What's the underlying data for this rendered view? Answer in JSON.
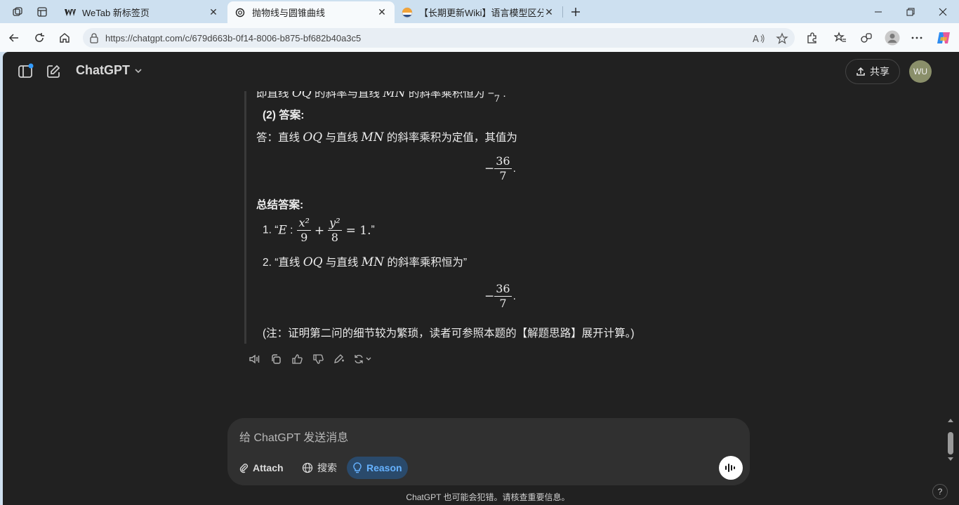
{
  "browser": {
    "tabs": [
      {
        "title": "WeTab 新标签页",
        "active": false
      },
      {
        "title": "抛物线与圆锥曲线",
        "active": true
      },
      {
        "title": "【长期更新Wiki】语言模型区分题",
        "active": false
      }
    ],
    "url": "https://chatgpt.com/c/679d663b-0f14-8006-b875-bf682b40a3c5"
  },
  "app": {
    "model_name": "ChatGPT",
    "share_label": "共享",
    "avatar_initials": "WU"
  },
  "message": {
    "cut_line": {
      "pre": "即直线 ",
      "m1": "OQ",
      "mid": " 的斜率与直线 ",
      "m2": "MN",
      "post": " 的斜率乘积恒为 −",
      "den": "7",
      "end": "."
    },
    "part2_heading": "(2) 答案:",
    "answer_line": {
      "pre": "答：直线 ",
      "m1": "OQ",
      "mid": " 与直线 ",
      "m2": "MN",
      "post": " 的斜率乘积为定值，其值为"
    },
    "value1": {
      "sign": "−",
      "num": "36",
      "den": "7",
      "end": "."
    },
    "summary_heading": "总结答案:",
    "item1": {
      "index": "1.",
      "open": "“",
      "E": "E",
      "colon": " :",
      "x2": "x²",
      "den1": "9",
      "plus": "+",
      "y2": "y²",
      "den2": "8",
      "eq": "= 1.",
      "close": "”"
    },
    "item2": {
      "index": "2.",
      "pre": "“直线 ",
      "m1": "OQ",
      "mid": " 与直线 ",
      "m2": "MN",
      "post": " 的斜率乘积恒为”"
    },
    "value2": {
      "sign": "−",
      "num": "36",
      "den": "7",
      "end": "."
    },
    "note": "(注：证明第二问的细节较为繁琐，读者可参照本题的【解题思路】展开计算。)"
  },
  "composer": {
    "placeholder": "给 ChatGPT 发送消息",
    "attach_label": "Attach",
    "search_label": "搜索",
    "reason_label": "Reason"
  },
  "footer": {
    "disclaimer": "ChatGPT 也可能会犯错。请核查重要信息。",
    "help": "?"
  },
  "colors": {
    "app_bg": "#212121",
    "composer_bg": "#303030",
    "reason_accent": "#66b2ff",
    "browser_frame": "#cde0f0"
  },
  "icons": [
    "workspaces-icon",
    "tab-actions-icon",
    "wetab-icon",
    "openai-icon",
    "wiki-icon",
    "close-icon",
    "new-tab-icon",
    "minimize-icon",
    "restore-icon",
    "window-close-icon",
    "back-icon",
    "refresh-icon",
    "home-icon",
    "lock-icon",
    "read-aloud-icon",
    "favorite-icon",
    "extensions-icon",
    "favorites-icon",
    "collections-icon",
    "profile-icon",
    "more-icon",
    "copilot-icon",
    "sidebar-toggle-icon",
    "new-chat-icon",
    "chevron-down-icon",
    "upload-icon",
    "read-aloud-icon",
    "copy-icon",
    "thumbs-up-icon",
    "thumbs-down-icon",
    "edit-icon",
    "regenerate-icon",
    "paperclip-icon",
    "globe-icon",
    "bulb-icon",
    "voice-icon"
  ]
}
